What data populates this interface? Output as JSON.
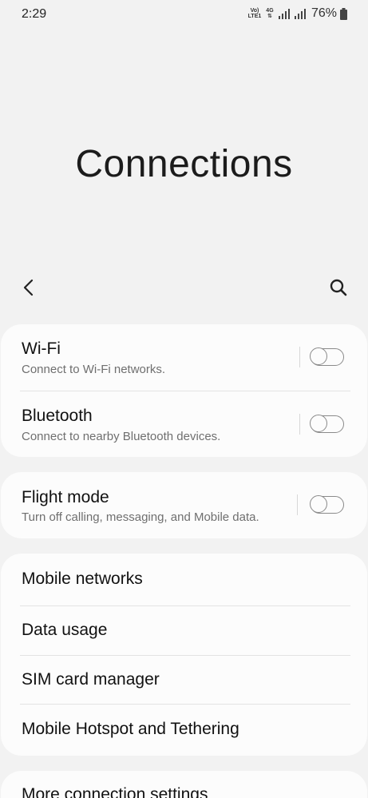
{
  "status_bar": {
    "time": "2:29",
    "volte_line1": "Vo)",
    "volte_line2": "LTE1",
    "network_type": "4G",
    "battery": "76%"
  },
  "header": {
    "title": "Connections"
  },
  "toggles": [
    {
      "title": "Wi-Fi",
      "subtitle": "Connect to Wi-Fi networks.",
      "on": false
    },
    {
      "title": "Bluetooth",
      "subtitle": "Connect to nearby Bluetooth devices.",
      "on": false
    },
    {
      "title": "Flight mode",
      "subtitle": "Turn off calling, messaging, and Mobile data.",
      "on": false
    }
  ],
  "menu": [
    {
      "title": "Mobile networks"
    },
    {
      "title": "Data usage"
    },
    {
      "title": "SIM card manager"
    },
    {
      "title": "Mobile Hotspot and Tethering"
    },
    {
      "title": "More connection settings"
    }
  ],
  "colors": {
    "background": "#f2f2f2",
    "card": "#fcfcfc",
    "subtitle": "#6f6f6f",
    "toggle_off": "#8a8a8a"
  },
  "icons": {
    "back": "back-arrow-icon",
    "search": "search-icon",
    "signal": "signal-icon",
    "battery": "battery-icon"
  }
}
